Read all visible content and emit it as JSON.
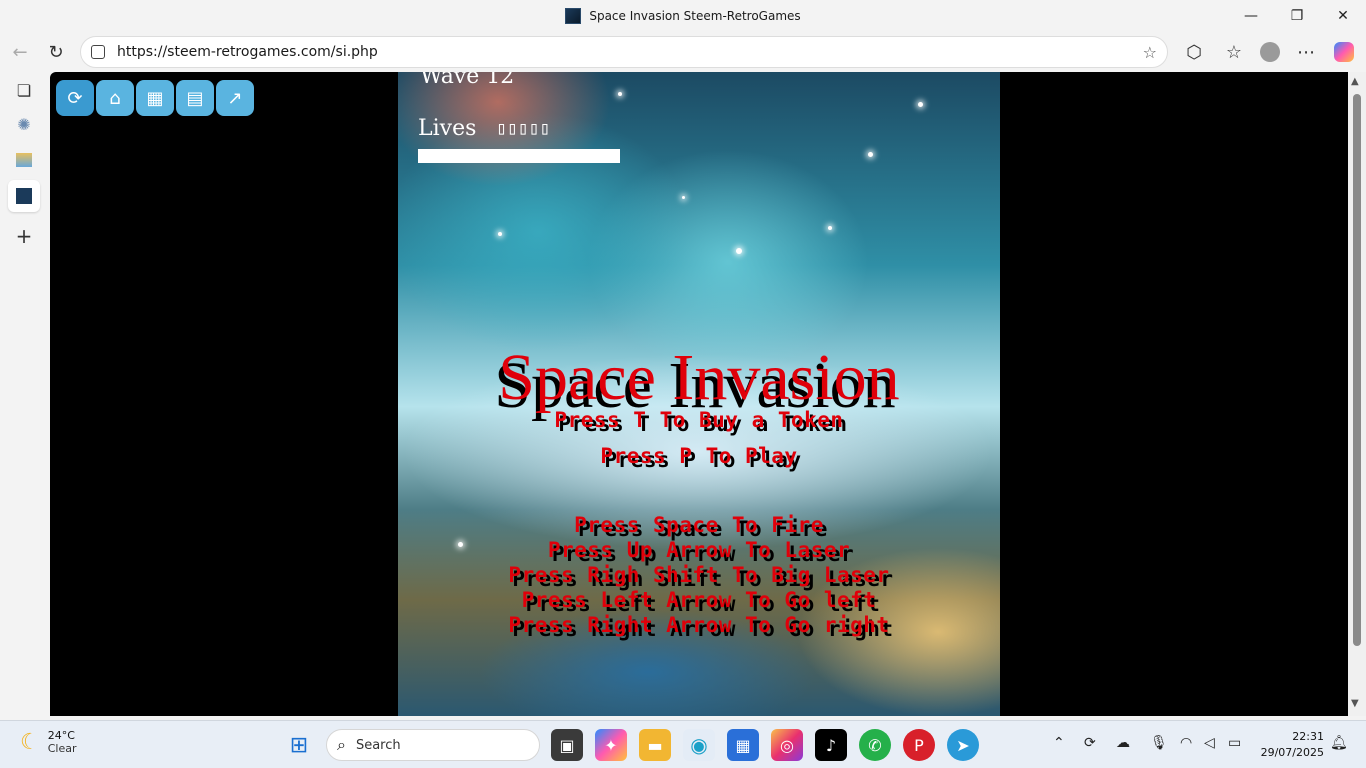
{
  "window": {
    "title": "Space Invasion Steem-RetroGames",
    "minimize_icon": "minimize-icon",
    "restore_icon": "restore-icon",
    "close_icon": "close-icon"
  },
  "browser": {
    "url": "https://steem-retrogames.com/si.php"
  },
  "site_toolbar": {
    "buttons": [
      {
        "name": "refresh-icon",
        "glyph": "⟳"
      },
      {
        "name": "home-icon",
        "glyph": "⌂"
      },
      {
        "name": "grid-icon",
        "glyph": "▦"
      },
      {
        "name": "clipboard-icon",
        "glyph": "▤"
      },
      {
        "name": "chart-icon",
        "glyph": "↗"
      }
    ]
  },
  "game": {
    "wave_label": "Wave 12",
    "lives_label": "Lives",
    "lives_glyphs": "▯▯▯▯▯",
    "title": "Space Invasion",
    "instructions": [
      "Press T To Buy a Token",
      "Press P To Play",
      "Press Space To Fire",
      "Press Up Arrow To Laser",
      "Press Righ Shift To Big Laser",
      "Press Left Arrow To Go left",
      "Press Right Arrow To Go right"
    ]
  },
  "taskbar": {
    "weather_temp": "24°C",
    "weather_desc": "Clear",
    "search_label": "Search",
    "time": "22:31",
    "date": "29/07/2025"
  },
  "colors": {
    "title_red": "#e0000a",
    "site_button": "#5ab4e0"
  }
}
